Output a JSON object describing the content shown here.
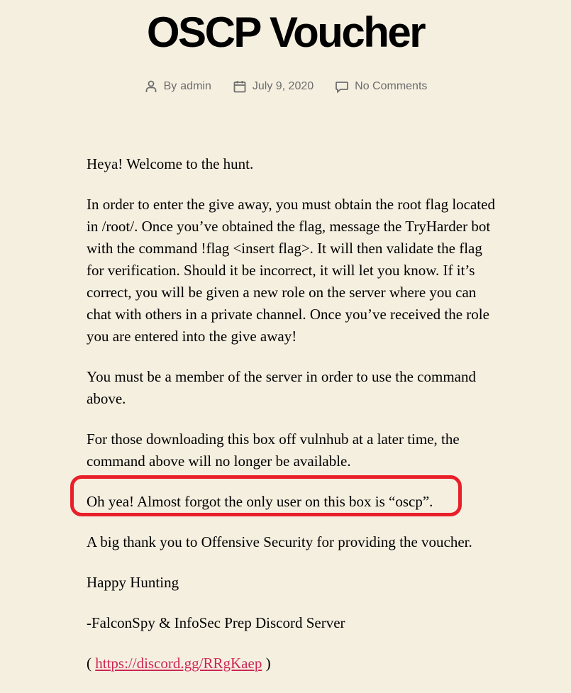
{
  "post": {
    "title": "OSCP Voucher",
    "author_prefix": "By",
    "author": "admin",
    "date": "July 9, 2020",
    "comments": "No Comments"
  },
  "content": {
    "p1": "Heya! Welcome to the hunt.",
    "p2": "In order to enter the give away, you must obtain the root flag located in /root/. Once you’ve obtained the flag, message the TryHarder bot with the command !flag <insert flag>. It will then validate the flag for verification. Should it be incorrect, it will let you know. If it’s correct, you will be given a new role on the server where you can chat with others in a private channel. Once you’ve received the role you are entered into the give away!",
    "p3": "You must be a member of the server in order to use the command above.",
    "p4": "For those downloading this box off vulnhub at a later time, the command above will no longer be available.",
    "p5": "Oh yea! Almost forgot the only user on this box is “oscp”.",
    "p6": "A big thank you to Offensive Security for providing the voucher.",
    "p7": "Happy Hunting",
    "p8": "-FalconSpy & InfoSec Prep Discord Server",
    "link_open": "(",
    "link_text": "https://discord.gg/RRgKaep",
    "link_close": ")"
  },
  "colors": {
    "background": "#f5efe0",
    "link": "#cd2653",
    "highlight": "#e8202a",
    "meta": "#6d6d6d"
  },
  "icons": {
    "author": "person-icon",
    "date": "calendar-icon",
    "comments": "comment-bubble-icon"
  }
}
